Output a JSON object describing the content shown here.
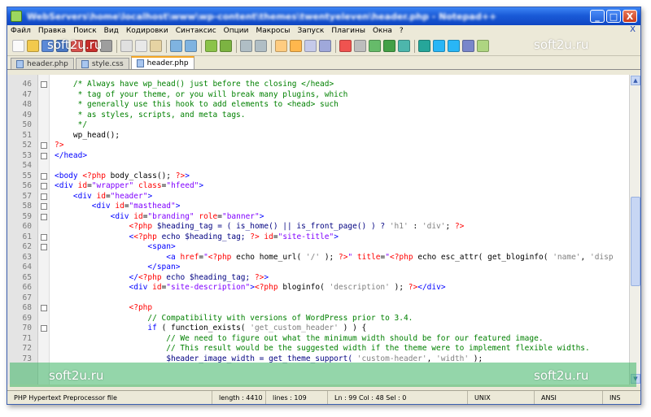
{
  "window": {
    "title": "WebServers\\home\\localhost\\www\\wp-content\\themes\\twentyeleven\\header.php - Notepad++",
    "buttons": {
      "minimize": "_",
      "maximize": "□",
      "close": "X"
    }
  },
  "menubar": {
    "items": [
      "Файл",
      "Правка",
      "Поиск",
      "Вид",
      "Кодировки",
      "Синтаксис",
      "Опции",
      "Макросы",
      "Запуск",
      "Плагины",
      "Окна",
      "?"
    ],
    "close": "X"
  },
  "colors": {
    "comment": "#008000",
    "keyword": "#0000ff",
    "string": "#808080",
    "php_tag": "#ff0000",
    "html_tag": "#0000ff",
    "attribute": "#ff0000",
    "attr_value": "#8000ff",
    "variable": "#000080",
    "plain": "#000000",
    "accent": "#f5a623"
  },
  "tabs": [
    {
      "label": "header.php",
      "active": false
    },
    {
      "label": "style.css",
      "active": false
    },
    {
      "label": "header.php",
      "active": true
    }
  ],
  "editor": {
    "lines": [
      {
        "n": "46",
        "fold": true,
        "segments": [
          [
            "    /* Always have wp_head() just before the closing </head>",
            "comment"
          ]
        ]
      },
      {
        "n": "47",
        "fold": false,
        "segments": [
          [
            "     * tag of your theme, or you will break many plugins, which",
            "comment"
          ]
        ]
      },
      {
        "n": "48",
        "fold": false,
        "segments": [
          [
            "     * generally use this hook to add elements to <head> such",
            "comment"
          ]
        ]
      },
      {
        "n": "49",
        "fold": false,
        "segments": [
          [
            "     * as styles, scripts, and meta tags.",
            "comment"
          ]
        ]
      },
      {
        "n": "50",
        "fold": false,
        "segments": [
          [
            "     */",
            "comment"
          ]
        ]
      },
      {
        "n": "51",
        "fold": false,
        "segments": [
          [
            "    wp_head();",
            "plain"
          ]
        ]
      },
      {
        "n": "52",
        "fold": true,
        "segments": [
          [
            "?>",
            "php_tag"
          ]
        ]
      },
      {
        "n": "53",
        "fold": true,
        "segments": [
          [
            "</head>",
            "html_tag"
          ]
        ]
      },
      {
        "n": "54",
        "fold": false,
        "segments": []
      },
      {
        "n": "55",
        "fold": true,
        "segments": [
          [
            "<body ",
            "html_tag"
          ],
          [
            "<?php",
            "php_tag"
          ],
          [
            " body_class(); ",
            "plain"
          ],
          [
            "?>",
            "php_tag"
          ],
          [
            ">",
            "html_tag"
          ]
        ]
      },
      {
        "n": "56",
        "fold": true,
        "segments": [
          [
            "<div ",
            "html_tag"
          ],
          [
            "id",
            "attribute"
          ],
          [
            "=",
            "plain"
          ],
          [
            "\"wrapper\"",
            "attr_value"
          ],
          [
            " ",
            "plain"
          ],
          [
            "class",
            "attribute"
          ],
          [
            "=",
            "plain"
          ],
          [
            "\"hfeed\"",
            "attr_value"
          ],
          [
            ">",
            "html_tag"
          ]
        ]
      },
      {
        "n": "57",
        "fold": true,
        "segments": [
          [
            "    <div ",
            "html_tag"
          ],
          [
            "id",
            "attribute"
          ],
          [
            "=",
            "plain"
          ],
          [
            "\"header\"",
            "attr_value"
          ],
          [
            ">",
            "html_tag"
          ]
        ]
      },
      {
        "n": "58",
        "fold": true,
        "segments": [
          [
            "        <div ",
            "html_tag"
          ],
          [
            "id",
            "attribute"
          ],
          [
            "=",
            "plain"
          ],
          [
            "\"masthead\"",
            "attr_value"
          ],
          [
            ">",
            "html_tag"
          ]
        ]
      },
      {
        "n": "59",
        "fold": true,
        "segments": [
          [
            "            <div ",
            "html_tag"
          ],
          [
            "id",
            "attribute"
          ],
          [
            "=",
            "plain"
          ],
          [
            "\"branding\"",
            "attr_value"
          ],
          [
            " ",
            "plain"
          ],
          [
            "role",
            "attribute"
          ],
          [
            "=",
            "plain"
          ],
          [
            "\"banner\"",
            "attr_value"
          ],
          [
            ">",
            "html_tag"
          ]
        ]
      },
      {
        "n": "60",
        "fold": false,
        "segments": [
          [
            "                ",
            "plain"
          ],
          [
            "<?php",
            "php_tag"
          ],
          [
            " $heading_tag = ( is_home() || is_front_page() ) ? ",
            "variable"
          ],
          [
            "'h1'",
            "string"
          ],
          [
            " : ",
            "plain"
          ],
          [
            "'div'",
            "string"
          ],
          [
            "; ",
            "plain"
          ],
          [
            "?>",
            "php_tag"
          ]
        ]
      },
      {
        "n": "61",
        "fold": true,
        "segments": [
          [
            "                <",
            "html_tag"
          ],
          [
            "<?php",
            "php_tag"
          ],
          [
            " echo $heading_tag; ",
            "variable"
          ],
          [
            "?>",
            "php_tag"
          ],
          [
            " ",
            "plain"
          ],
          [
            "id",
            "attribute"
          ],
          [
            "=",
            "plain"
          ],
          [
            "\"site-title\"",
            "attr_value"
          ],
          [
            ">",
            "html_tag"
          ]
        ]
      },
      {
        "n": "62",
        "fold": true,
        "segments": [
          [
            "                    <span>",
            "html_tag"
          ]
        ]
      },
      {
        "n": "63",
        "fold": false,
        "segments": [
          [
            "                        <a ",
            "html_tag"
          ],
          [
            "href",
            "attribute"
          ],
          [
            "=",
            "plain"
          ],
          [
            "\"",
            "attr_value"
          ],
          [
            "<?php",
            "php_tag"
          ],
          [
            " echo home_url( ",
            "plain"
          ],
          [
            "'/'",
            "string"
          ],
          [
            " ); ",
            "plain"
          ],
          [
            "?>",
            "php_tag"
          ],
          [
            "\"",
            "attr_value"
          ],
          [
            " ",
            "plain"
          ],
          [
            "title",
            "attribute"
          ],
          [
            "=",
            "plain"
          ],
          [
            "\"",
            "attr_value"
          ],
          [
            "<?php",
            "php_tag"
          ],
          [
            " echo esc_attr( get_bloginfo( ",
            "plain"
          ],
          [
            "'name'",
            "string"
          ],
          [
            ", ",
            "plain"
          ],
          [
            "'disp",
            "string"
          ]
        ]
      },
      {
        "n": "64",
        "fold": false,
        "segments": [
          [
            "                    </span>",
            "html_tag"
          ]
        ]
      },
      {
        "n": "65",
        "fold": false,
        "segments": [
          [
            "                </",
            "html_tag"
          ],
          [
            "<?php",
            "php_tag"
          ],
          [
            " echo $heading_tag; ",
            "variable"
          ],
          [
            "?>",
            "php_tag"
          ],
          [
            ">",
            "html_tag"
          ]
        ]
      },
      {
        "n": "66",
        "fold": false,
        "segments": [
          [
            "                <div ",
            "html_tag"
          ],
          [
            "id",
            "attribute"
          ],
          [
            "=",
            "plain"
          ],
          [
            "\"site-description\"",
            "attr_value"
          ],
          [
            ">",
            "html_tag"
          ],
          [
            "<?php",
            "php_tag"
          ],
          [
            " bloginfo( ",
            "plain"
          ],
          [
            "'description'",
            "string"
          ],
          [
            " ); ",
            "plain"
          ],
          [
            "?>",
            "php_tag"
          ],
          [
            "</div>",
            "html_tag"
          ]
        ]
      },
      {
        "n": "67",
        "fold": false,
        "segments": []
      },
      {
        "n": "68",
        "fold": true,
        "segments": [
          [
            "                ",
            "plain"
          ],
          [
            "<?php",
            "php_tag"
          ]
        ]
      },
      {
        "n": "69",
        "fold": false,
        "segments": [
          [
            "                    // Compatibility with versions of WordPress prior to 3.4.",
            "comment"
          ]
        ]
      },
      {
        "n": "70",
        "fold": true,
        "segments": [
          [
            "                    ",
            "plain"
          ],
          [
            "if",
            "keyword"
          ],
          [
            " ( function_exists( ",
            "plain"
          ],
          [
            "'get_custom_header'",
            "string"
          ],
          [
            " ) ) {",
            "plain"
          ]
        ]
      },
      {
        "n": "71",
        "fold": false,
        "segments": [
          [
            "                        // We need to figure out what the minimum width should be for our featured image.",
            "comment"
          ]
        ]
      },
      {
        "n": "72",
        "fold": false,
        "segments": [
          [
            "                        // This result would be the suggested width if the theme were to implement flexible widths.",
            "comment"
          ]
        ]
      },
      {
        "n": "73",
        "fold": false,
        "segments": [
          [
            "                        $header_image_width = get_theme_support( ",
            "variable"
          ],
          [
            "'custom-header'",
            "string"
          ],
          [
            ", ",
            "plain"
          ],
          [
            "'width'",
            "string"
          ],
          [
            " );",
            "plain"
          ]
        ]
      }
    ]
  },
  "statusbar": {
    "file_type": "PHP Hypertext Preprocessor file",
    "length": "length : 4410",
    "lines": "lines : 109",
    "position": "Ln : 99   Col : 48   Sel : 0",
    "eol": "UNIX",
    "encoding": "ANSI",
    "mode": "INS"
  },
  "watermarks": {
    "top_left": "soft2u.ru",
    "top_right": "soft2u.ru",
    "bottom_left": "soft2u.ru",
    "bottom_right": "soft2u.ru"
  }
}
